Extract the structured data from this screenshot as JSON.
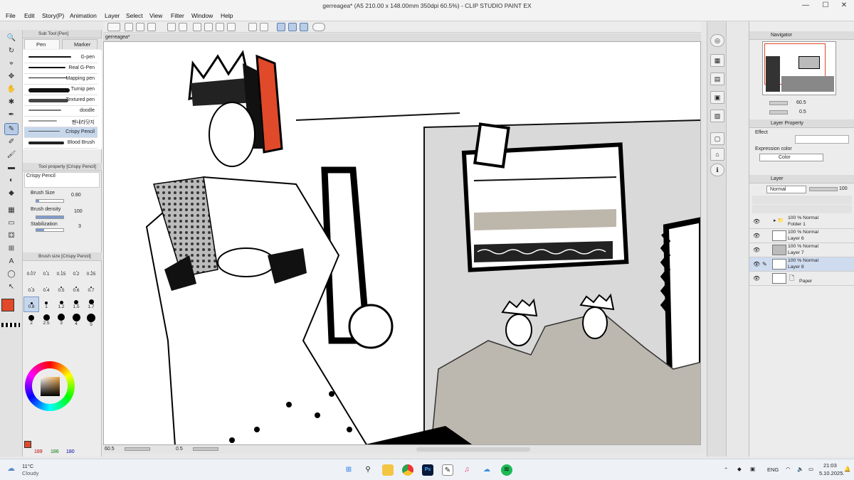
{
  "window": {
    "title": "gerreagea* (A5 210.00 x 148.00mm 350dpi 60.5%) - CLIP STUDIO PAINT EX",
    "minimize": "—",
    "maximize": "☐",
    "close": "✕"
  },
  "menu": [
    "File",
    "Edit",
    "Story(P)",
    "Animation",
    "Layer",
    "Select",
    "View",
    "Filter",
    "Window",
    "Help"
  ],
  "subtool": {
    "header": "Sub Tool [Pen]",
    "tabs": [
      "Pen",
      "Marker"
    ],
    "brushes": [
      "G-pen",
      "Real G-Pen",
      "Mapping pen",
      "Turnip pen",
      "Textured pen",
      "doodle",
      "펜내라닷지",
      "Crispy Pencil",
      "Blood Brush"
    ],
    "selected_brush": "Crispy Pencil"
  },
  "tool_property": {
    "header": "Tool property [Crispy Pencil]",
    "name": "Crispy Pencil",
    "brush_size_label": "Brush Size",
    "brush_size_value": "0.80",
    "brush_size_fraction": 0.1,
    "brush_density_label": "Brush density",
    "brush_density_value": "100",
    "brush_density_fraction": 1.0,
    "stabilization_label": "Stabilization",
    "stabilization_value": "3",
    "stabilization_fraction": 0.3
  },
  "brush_size_panel": {
    "header": "Brush size [Crispy Pencil]",
    "sizes": [
      "0.07",
      "0.1",
      "0.15",
      "0.2",
      "0.25",
      "0.3",
      "0.4",
      "0.5",
      "0.6",
      "0.7",
      "0.8",
      "1",
      "1.2",
      "1.5",
      "1.7",
      "2",
      "2.5",
      "3",
      "4",
      "5"
    ],
    "selected": "0.8"
  },
  "color": {
    "main": "#e0492a",
    "sub": "#ffffff",
    "r": "189",
    "g": "186",
    "b": "180"
  },
  "canvas": {
    "tab_label": "gerreagea*",
    "zoom": "60.5",
    "angle": "0.5"
  },
  "navigator": {
    "header": "Navigator",
    "zoom": "60.5",
    "angle": "0.5"
  },
  "layer_property": {
    "header": "Layer Property",
    "effect_label": "Effect",
    "expression_label": "Expression color",
    "expression_value": "Color"
  },
  "layers": {
    "header": "Layer",
    "blend_mode": "Normal",
    "opacity": "100",
    "items": [
      {
        "line1": "100 % Normal",
        "line2": "Folder 1",
        "kind": "folder"
      },
      {
        "line1": "100 % Normal",
        "line2": "Layer 6",
        "kind": "raster"
      },
      {
        "line1": "100 % Normal",
        "line2": "Layer 7",
        "kind": "raster"
      },
      {
        "line1": "100 % Normal",
        "line2": "Layer 8",
        "kind": "raster",
        "selected": true
      },
      {
        "line1": "",
        "line2": "Paper",
        "kind": "paper"
      }
    ]
  },
  "taskbar": {
    "weather_temp": "11°C",
    "weather_desc": "Cloudy",
    "language": "ENG",
    "time": "21:03",
    "date": "5.10.2025."
  },
  "accent": "#e0492a"
}
